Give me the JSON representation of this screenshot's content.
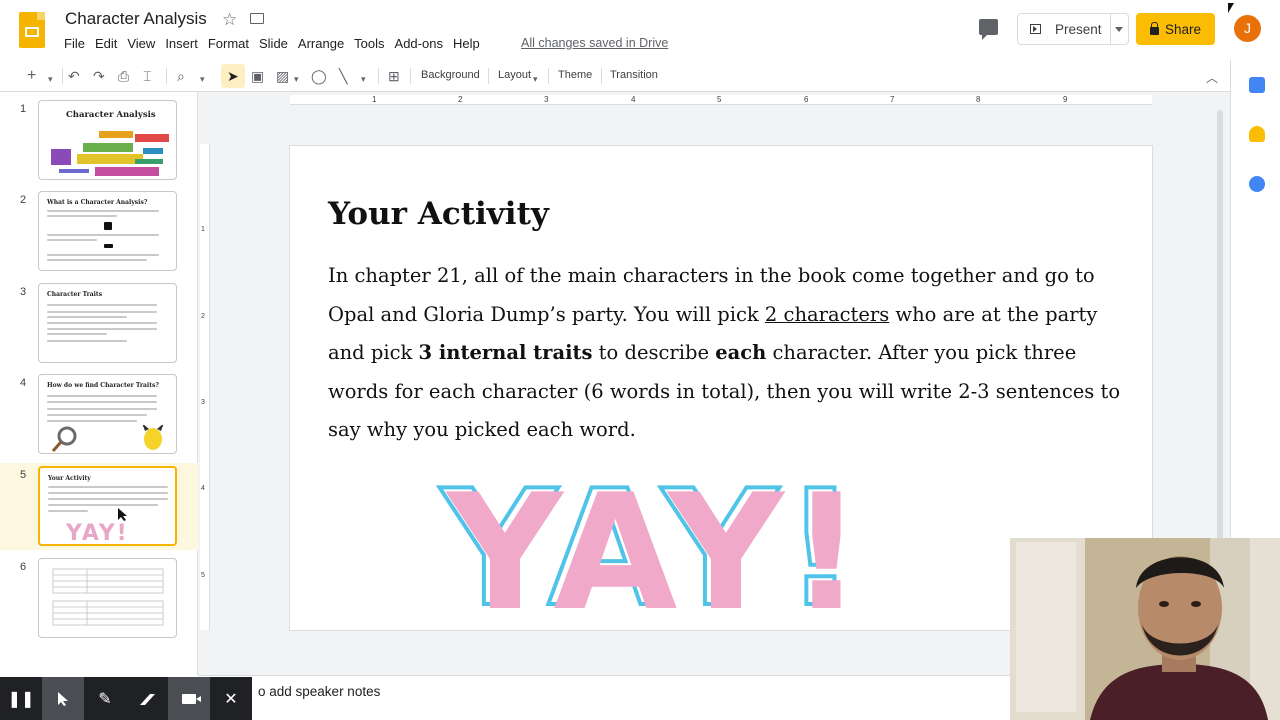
{
  "header": {
    "title": "Character Analysis",
    "menu": [
      "File",
      "Edit",
      "View",
      "Insert",
      "Format",
      "Slide",
      "Arrange",
      "Tools",
      "Add-ons",
      "Help"
    ],
    "saved_status": "All changes saved in Drive",
    "present_label": "Present",
    "share_label": "Share",
    "avatar_initial": "J"
  },
  "toolbar": {
    "background_label": "Background",
    "layout_label": "Layout",
    "theme_label": "Theme",
    "transition_label": "Transition"
  },
  "filmstrip": {
    "numbers": [
      "1",
      "2",
      "3",
      "4",
      "5",
      "6"
    ],
    "thumb_titles": [
      "Character Analysis",
      "What is a Character Analysis?",
      "Character Traits",
      "How do we find Character Traits?",
      "Your Activity",
      ""
    ],
    "selected_slide": 5
  },
  "ruler": {
    "h_ticks": [
      "1",
      "2",
      "3",
      "4",
      "5",
      "6",
      "7",
      "8",
      "9"
    ],
    "v_ticks": [
      "1",
      "2",
      "3",
      "4",
      "5"
    ]
  },
  "slide": {
    "heading": "Your Activity",
    "body_1": "In chapter 21, all of the main characters in the book come together and go to Opal and Gloria Dump’s party. You will pick ",
    "body_u": "2 characters",
    "body_2": " who are at the party and pick ",
    "body_b1": "3 internal traits",
    "body_3": " to describe ",
    "body_b2": "each",
    "body_4": " character. After you pick three words for each character (6 words in total), then you will write 2-3 sentences to say why you picked each word.",
    "yay_text": "YAY!",
    "yay_fill": "#f0a9c8",
    "yay_outline": "#4fc3e8"
  },
  "notes": {
    "text": "o add speaker notes"
  },
  "colors": {
    "accent": "#f4b400",
    "share": "#fbbc04",
    "avatar": "#e8710a"
  }
}
